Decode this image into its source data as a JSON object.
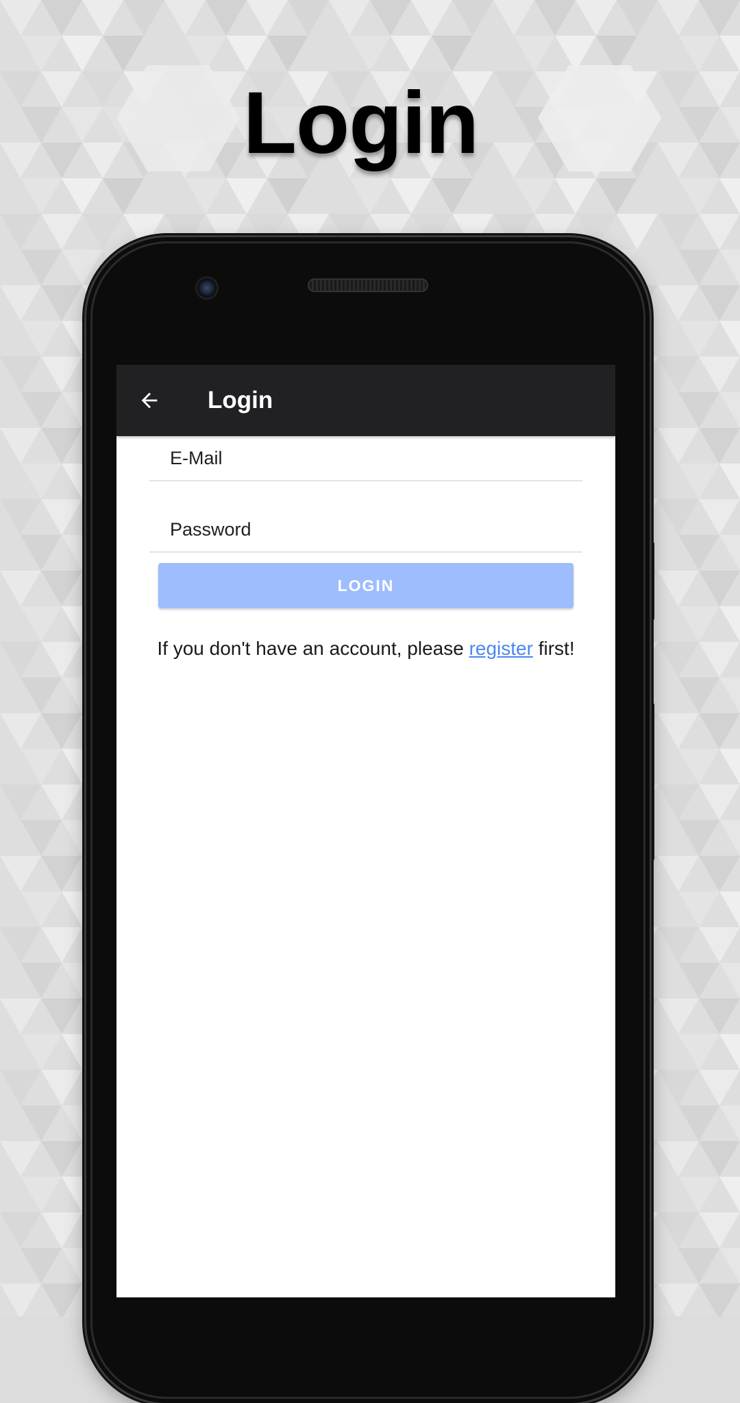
{
  "headline": "Login",
  "app_bar": {
    "title": "Login",
    "back_icon": "arrow-left-icon"
  },
  "form": {
    "email_placeholder": "E-Mail",
    "password_placeholder": "Password",
    "login_button_label": "LOGIN"
  },
  "register_prompt": {
    "before": "If you don't have an account, please ",
    "link": "register",
    "after": " first!"
  },
  "colors": {
    "app_bar": "#212124",
    "login_button": "#9dbdfd",
    "link": "#4a87f0",
    "background": "#dcdcdc"
  }
}
